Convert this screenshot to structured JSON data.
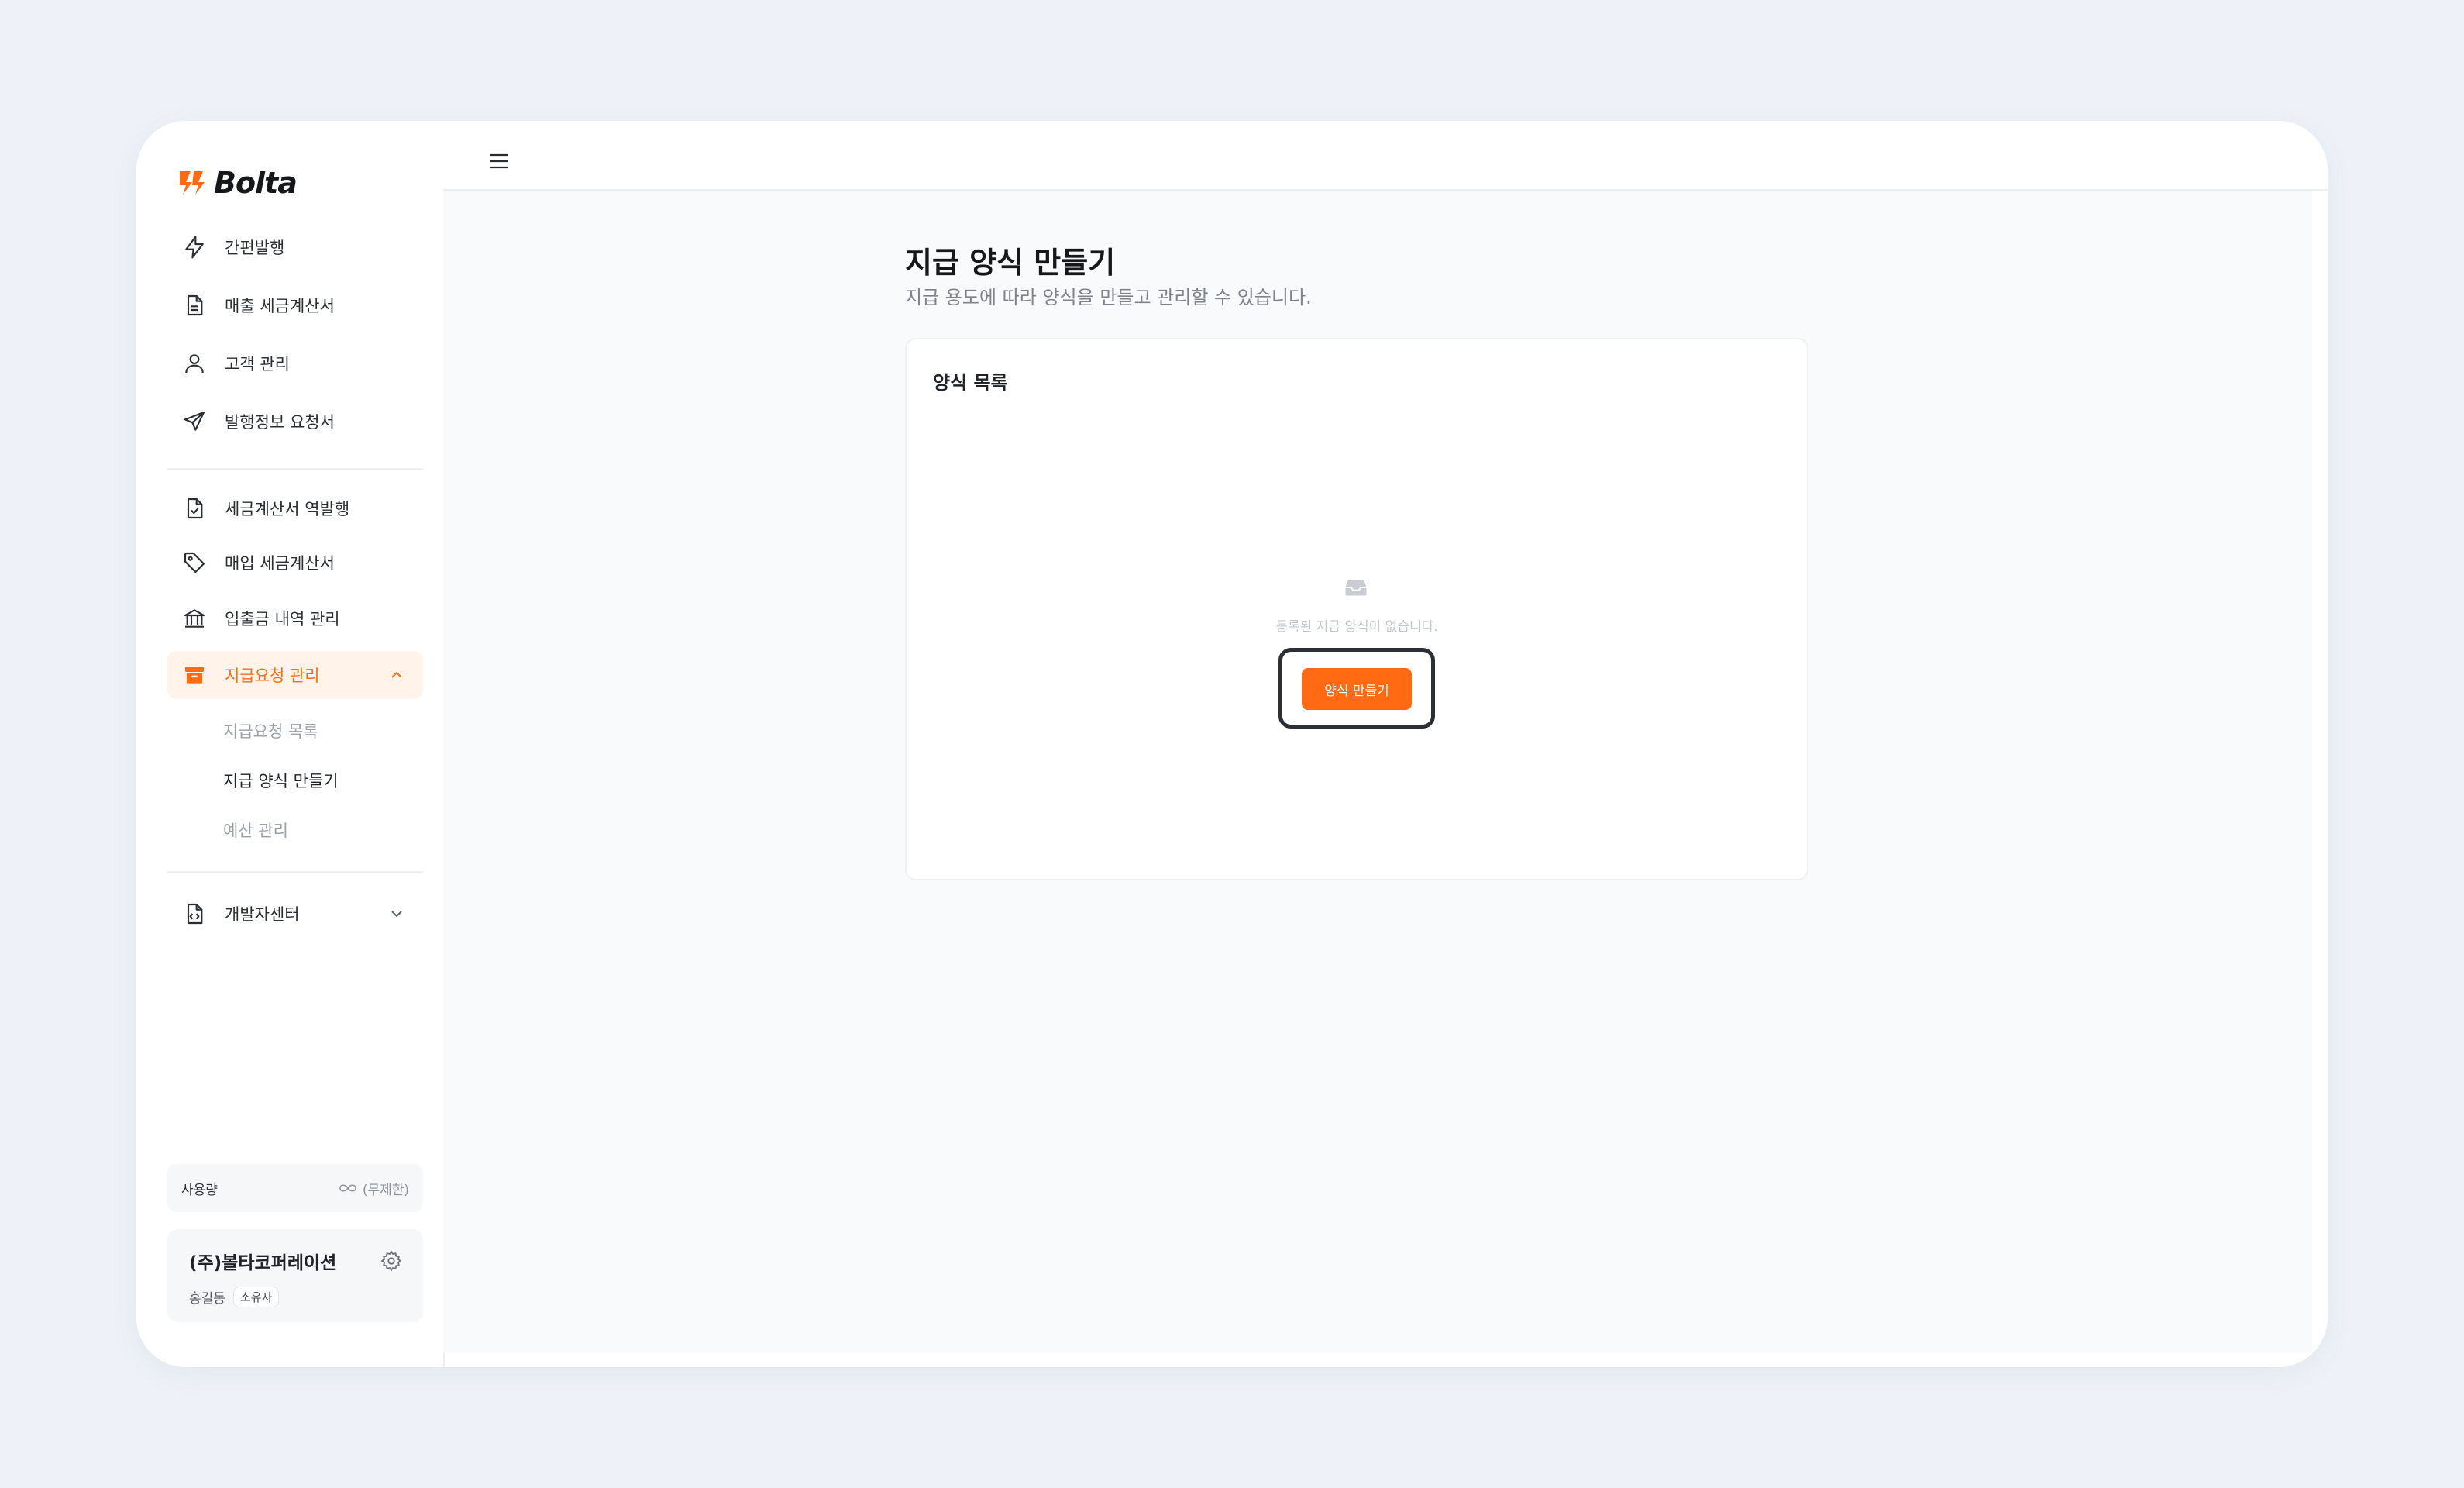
{
  "brand": {
    "name": "Bolta",
    "color": "#ff6a13"
  },
  "sidebar": {
    "items": [
      {
        "label": "간편발행",
        "icon": "bolt-icon"
      },
      {
        "label": "매출 세금계산서",
        "icon": "document-icon"
      },
      {
        "label": "고객 관리",
        "icon": "user-icon"
      },
      {
        "label": "발행정보 요청서",
        "icon": "send-icon"
      },
      {
        "label": "세금계산서 역발행",
        "icon": "document-check-icon"
      },
      {
        "label": "매입 세금계산서",
        "icon": "tag-icon"
      },
      {
        "label": "입출금 내역 관리",
        "icon": "bank-icon"
      },
      {
        "label": "지급요청 관리",
        "icon": "archive-icon",
        "active": true
      },
      {
        "label": "개발자센터",
        "icon": "code-file-icon"
      }
    ],
    "sub_items": [
      {
        "label": "지급요청 목록"
      },
      {
        "label": "지급 양식 만들기",
        "current": true
      },
      {
        "label": "예산 관리"
      }
    ],
    "usage": {
      "label": "사용량",
      "value": "(무제한)"
    },
    "company": {
      "name": "(주)볼타코퍼레이션",
      "user": "홍길동",
      "role": "소유자"
    }
  },
  "main": {
    "title": "지급 양식 만들기",
    "subtitle": "지급 용도에 따라 양식을 만들고 관리할 수 있습니다.",
    "card": {
      "title": "양식 목록",
      "empty_text": "등록된 지급 양식이 없습니다.",
      "create_button": "양식 만들기"
    }
  }
}
